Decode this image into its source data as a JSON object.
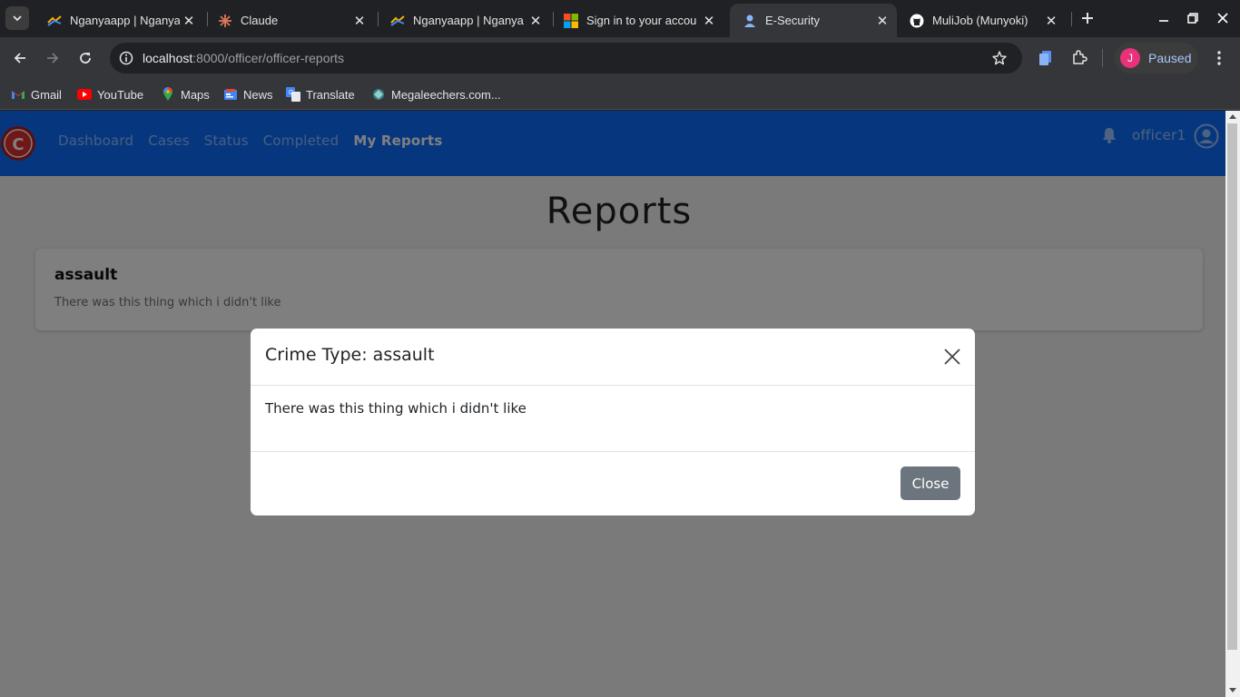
{
  "browser": {
    "tabs": [
      {
        "title": "Nganyaapp | Nganya",
        "active": false
      },
      {
        "title": "Claude",
        "active": false
      },
      {
        "title": "Nganyaapp | Nganya",
        "active": false
      },
      {
        "title": "Sign in to your accou",
        "active": false
      },
      {
        "title": "E-Security",
        "active": true
      },
      {
        "title": "MuliJob (Munyoki)",
        "active": false
      }
    ],
    "url_host": "localhost",
    "url_path": ":8000/officer/officer-reports",
    "profile_initial": "J",
    "profile_status": "Paused",
    "bookmarks": [
      {
        "label": "Gmail",
        "icon": "gmail-icon"
      },
      {
        "label": "YouTube",
        "icon": "youtube-icon"
      },
      {
        "label": "Maps",
        "icon": "maps-icon"
      },
      {
        "label": "News",
        "icon": "news-icon"
      },
      {
        "label": "Translate",
        "icon": "translate-icon"
      },
      {
        "label": "Megaleechers.com...",
        "icon": "megaleechers-icon"
      }
    ]
  },
  "app": {
    "nav": {
      "links": [
        "Dashboard",
        "Cases",
        "Status",
        "Completed",
        "My Reports"
      ],
      "active": "My Reports",
      "username": "officer1"
    },
    "page_title": "Reports",
    "reports": [
      {
        "crime_type": "assault",
        "description": "There was this thing which i didn't like"
      }
    ]
  },
  "modal": {
    "title": "Crime Type: assault",
    "body": "There was this thing which i didn't like",
    "close_label": "Close"
  },
  "colors": {
    "navbar": "#0d6efd",
    "close_button": "#6c757d",
    "backdrop": "rgba(0,0,0,0.5)"
  }
}
